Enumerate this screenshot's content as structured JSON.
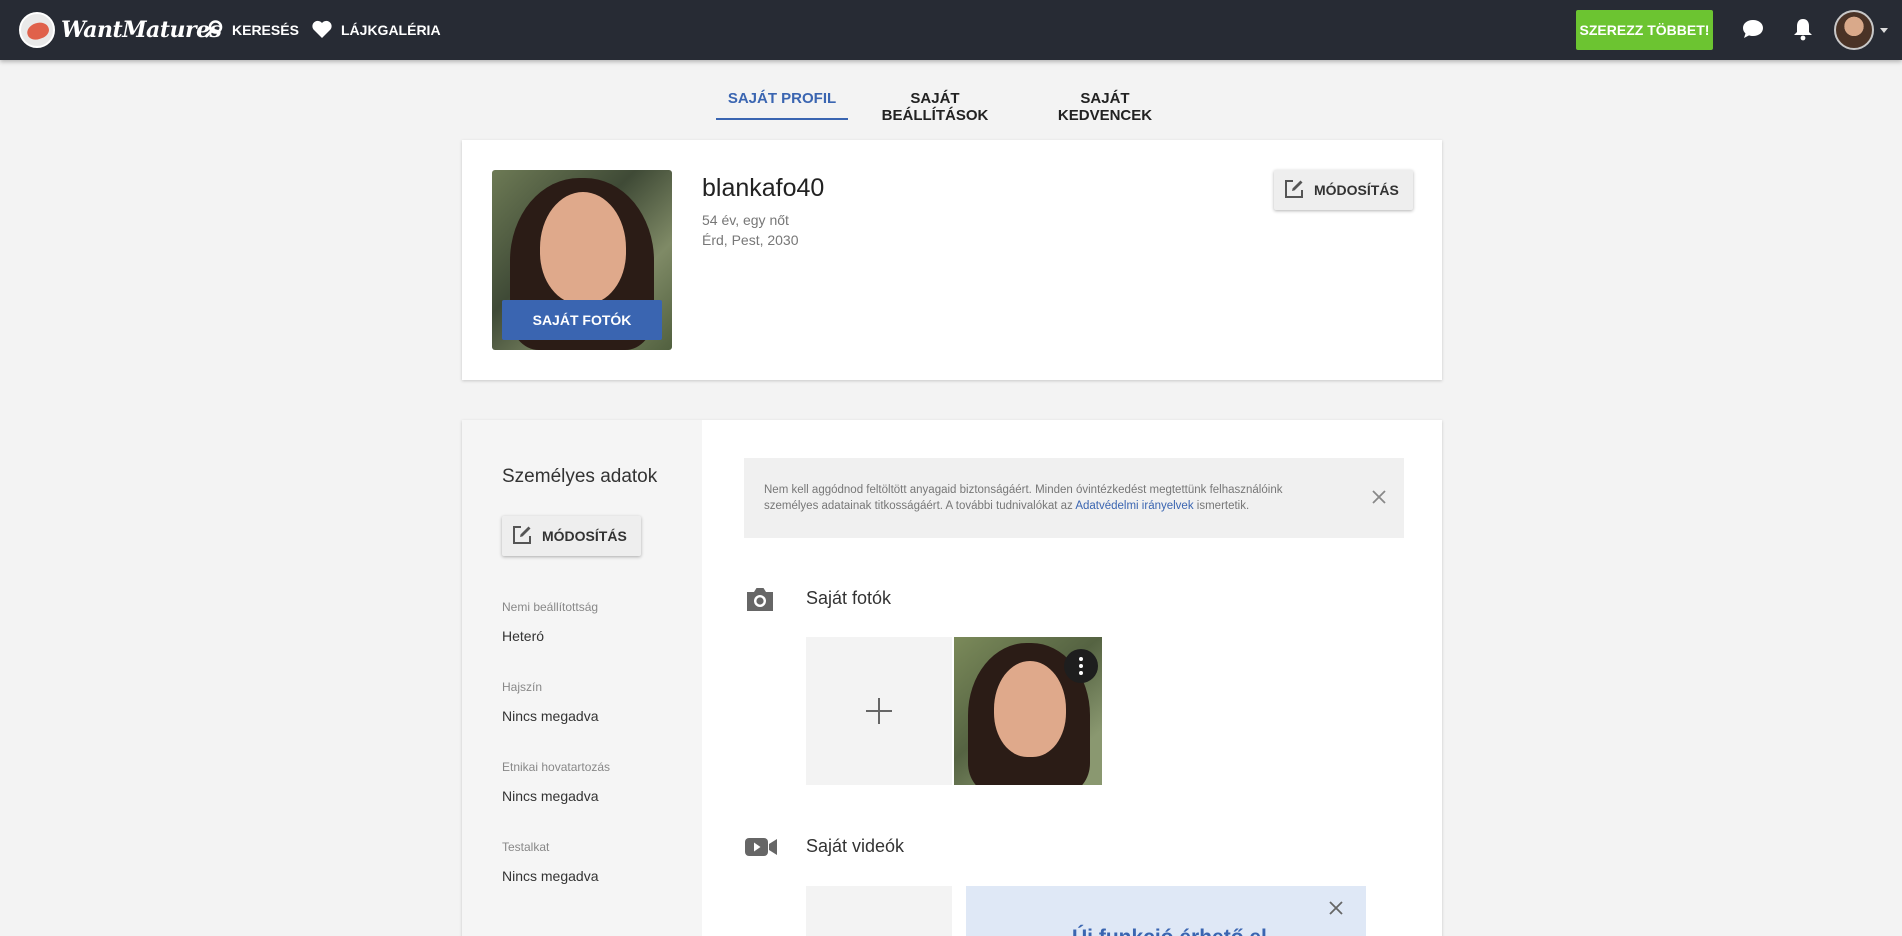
{
  "header": {
    "logo_text": "WantMatures",
    "nav": [
      {
        "label": "KERESÉS",
        "icon": "search-icon"
      },
      {
        "label": "LÁJKGALÉRIA",
        "icon": "heart-icon"
      }
    ],
    "cta_label": "SZEREZZ TÖBBET!",
    "icons": [
      "chat-bubble-icon",
      "bell-icon"
    ],
    "accent_green": "#6cc431",
    "bar_color": "#272b34"
  },
  "tabs": [
    {
      "label": "SAJÁT PROFIL",
      "active": true
    },
    {
      "label": "SAJÁT BEÁLLÍTÁSOK",
      "active": false
    },
    {
      "label": "SAJÁT KEDVENCEK",
      "active": false
    }
  ],
  "profile": {
    "username": "blankafo40",
    "age_line": "54 év, egy nőt",
    "location_line": "Érd, Pest, 2030",
    "photos_button": "SAJÁT FOTÓK",
    "edit_button": "MÓDOSÍTÁS",
    "accent_blue": "#3a65b1"
  },
  "personal": {
    "title": "Személyes adatok",
    "edit_button": "MÓDOSÍTÁS",
    "fields": [
      {
        "label": "Nemi beállítottság",
        "value": "Heteró"
      },
      {
        "label": "Hajszín",
        "value": "Nincs megadva"
      },
      {
        "label": "Etnikai hovatartozás",
        "value": "Nincs megadva"
      },
      {
        "label": "Testalkat",
        "value": "Nincs megadva"
      }
    ]
  },
  "notice": {
    "text_before": "Nem kell aggódnod feltöltött anyagaid biztonságáért. Minden óvintézkedést megtettünk felhasználóink személyes adatainak titkosságáért. A további tudnivalókat az ",
    "link": "Adatvédelmi irányelvek",
    "text_after": " ismertetik."
  },
  "photos_section": {
    "title": "Saját fotók",
    "icon": "camera-icon"
  },
  "videos_section": {
    "title": "Saját videók",
    "icon": "video-camera-icon"
  },
  "video_promo": {
    "text": "Új funkció érhető el"
  }
}
